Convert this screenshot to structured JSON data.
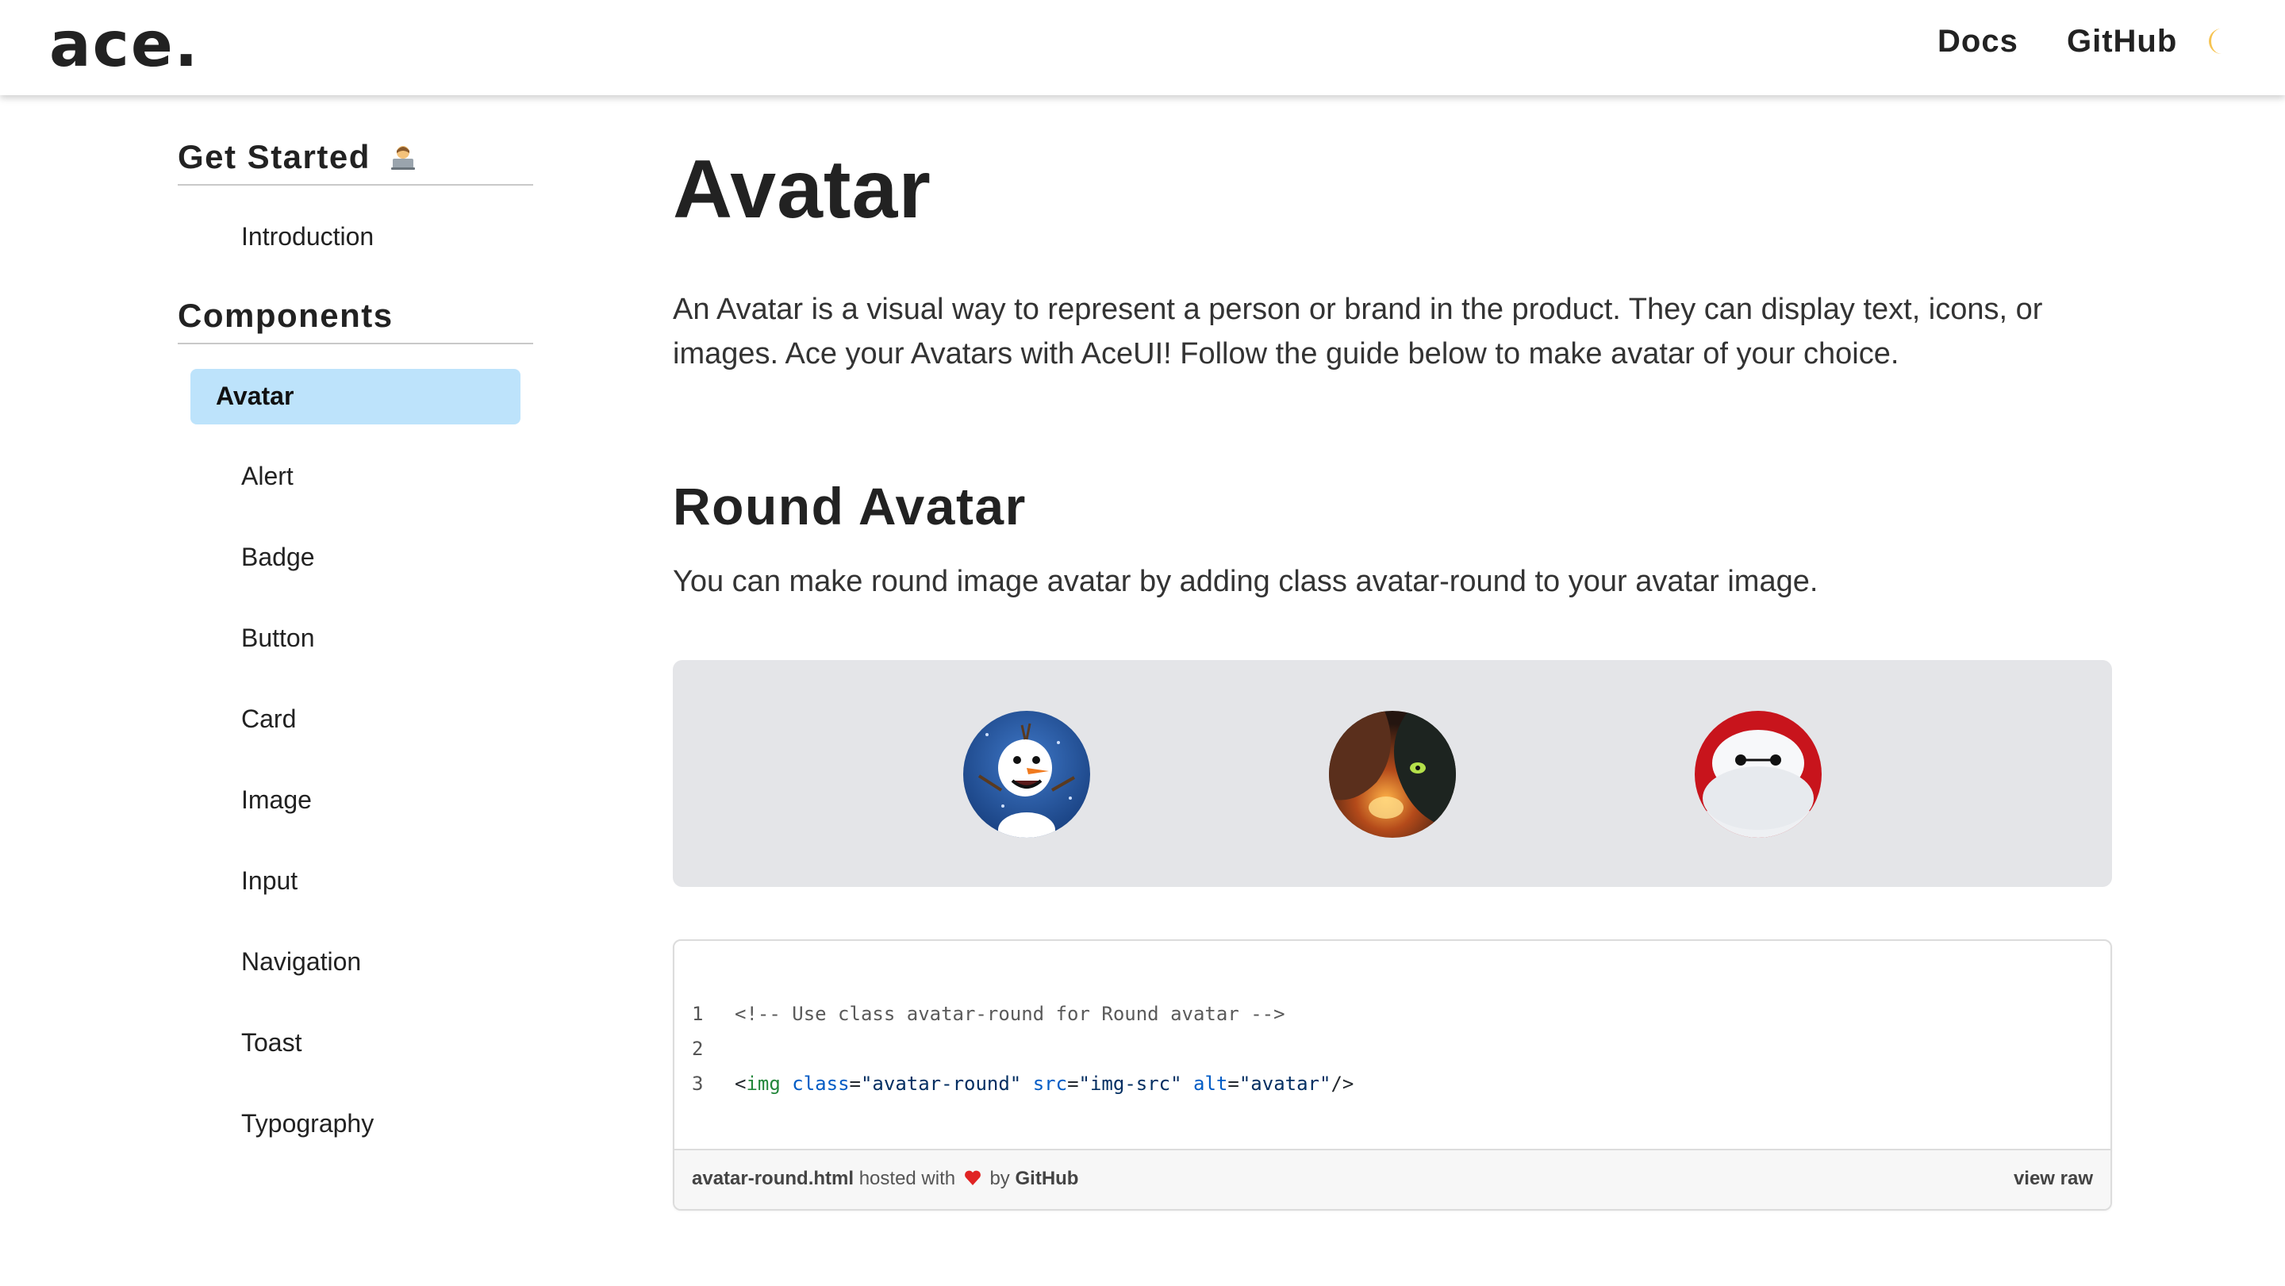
{
  "header": {
    "brand": "ace.",
    "nav": {
      "docs": "Docs",
      "github": "GitHub"
    },
    "theme_icon": "moon-icon"
  },
  "sidebar": {
    "get_started": {
      "title": "Get Started",
      "emoji_icon": "person-on-laptop-emoji",
      "items": [
        "Introduction"
      ]
    },
    "components": {
      "title": "Components",
      "active": "Avatar",
      "items": [
        "Alert",
        "Badge",
        "Button",
        "Card",
        "Image",
        "Input",
        "Navigation",
        "Toast",
        "Typography"
      ]
    }
  },
  "main": {
    "title": "Avatar",
    "lead": "An Avatar is a visual way to represent a person or brand in the product. They can display text, icons, or images. Ace your Avatars with AceUI! Follow the guide below to make avatar of your choice.",
    "section": {
      "title": "Round Avatar",
      "text": "You can make round image avatar by adding class avatar-round to your avatar image.",
      "avatars": [
        "olaf-snowman-avatar",
        "dragon-rider-avatar",
        "baymax-robot-avatar"
      ],
      "code": {
        "line_numbers": [
          "1",
          "2",
          "3"
        ],
        "line1": "<!-- Use class avatar-round for Round avatar -->",
        "line3": {
          "open": "<",
          "tag": "img",
          "attr1": "class",
          "val1": "\"avatar-round\"",
          "attr2": "src",
          "val2": "\"img-src\"",
          "attr3": "alt",
          "val3": "\"avatar\"",
          "close": "/>"
        }
      },
      "gist_footer": {
        "filename": "avatar-round.html",
        "hosted_with": "hosted with",
        "by": "by",
        "host": "GitHub",
        "view_raw": "view raw"
      }
    }
  },
  "colors": {
    "active_bg": "#bde3fb",
    "demo_bg": "#e4e5e8",
    "text": "#222222"
  }
}
